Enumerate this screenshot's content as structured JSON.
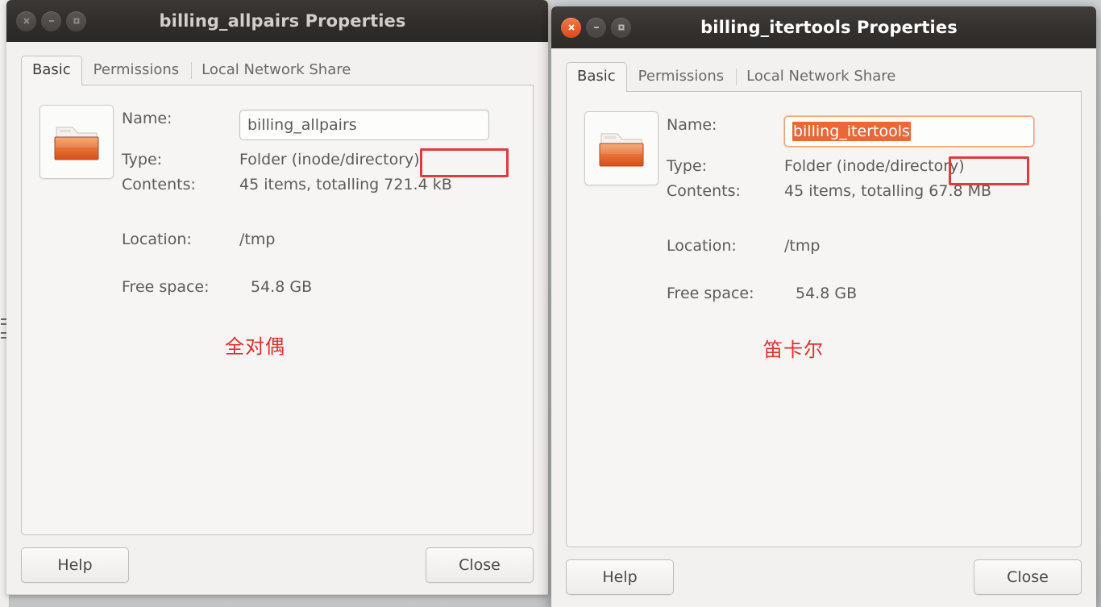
{
  "desktop": {
    "background_color": "#c8cacb"
  },
  "windows": [
    {
      "id": "left",
      "state": "inactive",
      "title": "billing_allpairs Properties",
      "controls": {
        "close": "close-icon",
        "minimize": "minimize-icon",
        "maximize": "maximize-icon"
      },
      "tabs": [
        {
          "label": "Basic",
          "selected": true
        },
        {
          "label": "Permissions",
          "selected": false
        },
        {
          "label": "Local Network Share",
          "selected": false
        }
      ],
      "icon": "folder-icon",
      "fields": {
        "name_label": "Name:",
        "name_value": "billing_allpairs",
        "name_selected": false,
        "type_label": "Type:",
        "type_value": "Folder (inode/directory)",
        "contents_label": "Contents:",
        "contents_prefix": "45 items, totalling ",
        "contents_size": "721.4 kB",
        "location_label": "Location:",
        "location_value": "/tmp",
        "freespace_label": "Free space:",
        "freespace_value": "54.8 GB"
      },
      "annotation": {
        "text": "全对偶",
        "color": "#e03030"
      },
      "highlight_color": "#e03b3b",
      "buttons": {
        "help": "Help",
        "close": "Close"
      }
    },
    {
      "id": "right",
      "state": "active",
      "title": "billing_itertools Properties",
      "controls": {
        "close": "close-icon",
        "minimize": "minimize-icon",
        "maximize": "maximize-icon"
      },
      "tabs": [
        {
          "label": "Basic",
          "selected": true
        },
        {
          "label": "Permissions",
          "selected": false
        },
        {
          "label": "Local Network Share",
          "selected": false
        }
      ],
      "icon": "folder-icon",
      "fields": {
        "name_label": "Name:",
        "name_value": "billing_itertools",
        "name_selected": true,
        "type_label": "Type:",
        "type_value": "Folder (inode/directory)",
        "contents_label": "Contents:",
        "contents_prefix": "45 items, totalling ",
        "contents_size": "67.8 MB",
        "location_label": "Location:",
        "location_value": "/tmp",
        "freespace_label": "Free space:",
        "freespace_value": "54.8 GB"
      },
      "annotation": {
        "text": "笛卡尔",
        "color": "#e03030"
      },
      "highlight_color": "#e03b3b",
      "buttons": {
        "help": "Help",
        "close": "Close"
      }
    }
  ]
}
